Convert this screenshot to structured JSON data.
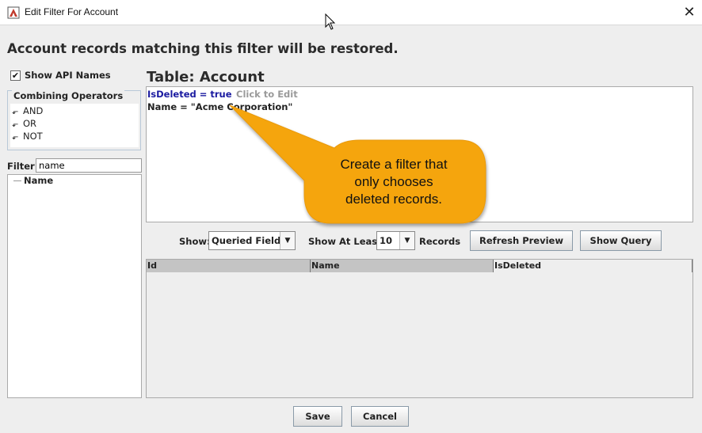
{
  "window": {
    "title": "Edit Filter For Account",
    "close_glyph": "✕"
  },
  "heading": "Account records matching this filter will be restored.",
  "sidebar": {
    "show_api_names": {
      "label": "Show API Names",
      "checked": true,
      "check_glyph": "✔"
    },
    "combining_operators": {
      "legend": "Combining Operators",
      "items": [
        {
          "icon": "operator-icon",
          "label": "AND"
        },
        {
          "icon": "operator-icon",
          "label": "OR"
        },
        {
          "icon": "operator-icon",
          "label": "NOT"
        }
      ]
    },
    "filter": {
      "label": "Filter:",
      "value": "name"
    },
    "field_tree": [
      {
        "label": "Name"
      }
    ]
  },
  "table": {
    "title": "Table: Account",
    "conditions": [
      {
        "text": "IsDeleted = true",
        "color": "#1a1aa0"
      },
      {
        "text": "Name = \"Acme Corporation\"",
        "color": "#222222"
      }
    ],
    "click_to_edit": "Click to Edit"
  },
  "callout": {
    "text_lines": [
      "Create a filter that",
      "only chooses",
      "deleted records."
    ],
    "fill": "#f5a50a"
  },
  "controls": {
    "show_label": "Show:",
    "show_value": "Queried Fields",
    "show_at_least_label": "Show At Least",
    "show_at_least_value": "10",
    "records_label": "Records",
    "refresh_preview": "Refresh Preview",
    "show_query": "Show Query"
  },
  "results": {
    "columns": [
      "Id",
      "Name",
      "IsDeleted"
    ]
  },
  "footer": {
    "save": "Save",
    "cancel": "Cancel"
  }
}
